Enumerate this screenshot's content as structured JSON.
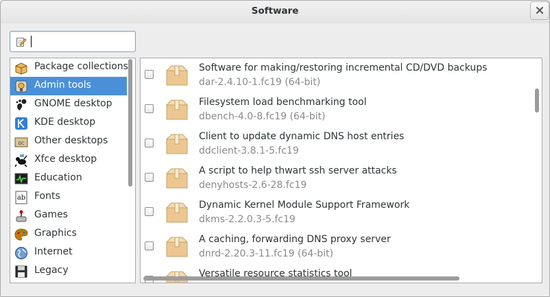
{
  "window": {
    "title": "Software"
  },
  "search": {
    "value": "",
    "placeholder": ""
  },
  "categories": [
    {
      "label": "Package collections",
      "icon": "package-collections-icon",
      "selected": false
    },
    {
      "label": "Admin tools",
      "icon": "admin-tools-icon",
      "selected": true
    },
    {
      "label": "GNOME desktop",
      "icon": "gnome-icon",
      "selected": false
    },
    {
      "label": "KDE desktop",
      "icon": "kde-icon",
      "selected": false
    },
    {
      "label": "Other desktops",
      "icon": "other-desktops-icon",
      "selected": false
    },
    {
      "label": "Xfce desktop",
      "icon": "xfce-icon",
      "selected": false
    },
    {
      "label": "Education",
      "icon": "education-icon",
      "selected": false
    },
    {
      "label": "Fonts",
      "icon": "fonts-icon",
      "selected": false
    },
    {
      "label": "Games",
      "icon": "games-icon",
      "selected": false
    },
    {
      "label": "Graphics",
      "icon": "graphics-icon",
      "selected": false
    },
    {
      "label": "Internet",
      "icon": "internet-icon",
      "selected": false
    },
    {
      "label": "Legacy",
      "icon": "legacy-icon",
      "selected": false
    }
  ],
  "packages": [
    {
      "summary": "Software for making/restoring incremental CD/DVD backups",
      "name": "dar-2.4.10-1.fc19 (64-bit)",
      "checked": false
    },
    {
      "summary": "Filesystem load benchmarking tool",
      "name": "dbench-4.0-8.fc19 (64-bit)",
      "checked": false
    },
    {
      "summary": "Client to update dynamic DNS host entries",
      "name": "ddclient-3.8.1-5.fc19",
      "checked": false
    },
    {
      "summary": "A script to help thwart ssh server attacks",
      "name": "denyhosts-2.6-28.fc19",
      "checked": false
    },
    {
      "summary": "Dynamic Kernel Module Support Framework",
      "name": "dkms-2.2.0.3-5.fc19",
      "checked": false
    },
    {
      "summary": "A caching, forwarding DNS proxy server",
      "name": "dnrd-2.20.3-11.fc19 (64-bit)",
      "checked": false
    },
    {
      "summary": "Versatile resource statistics tool",
      "name": "",
      "checked": false
    }
  ],
  "colors": {
    "selection": "#4a90d9",
    "secondary_text": "#8a8a8a"
  }
}
